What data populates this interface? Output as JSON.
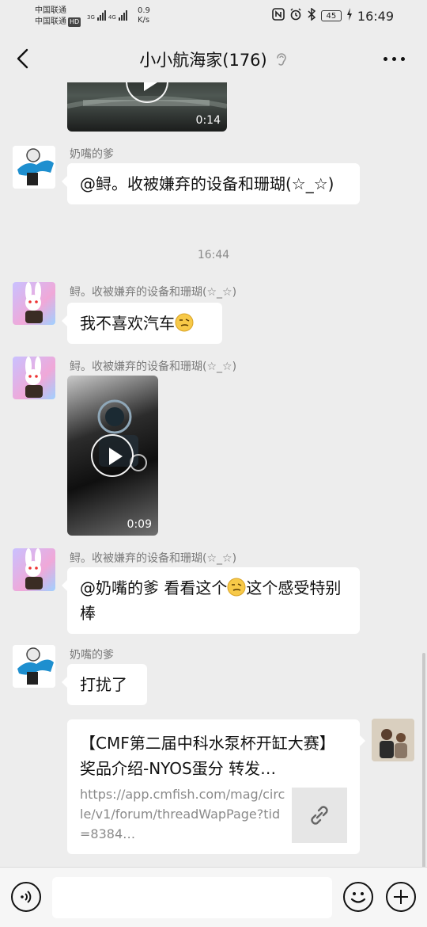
{
  "status_bar": {
    "carrier_1": "中国联通",
    "carrier_2": "中国联通",
    "hd": "HD",
    "net_1": "3G",
    "net_2": "4G",
    "speed_value": "0.9",
    "speed_unit": "K/s",
    "battery": "45",
    "time": "16:49"
  },
  "header": {
    "title": "小小航海家(176)"
  },
  "messages": [
    {
      "type": "video",
      "duration": "0:14"
    },
    {
      "type": "text",
      "sender": "奶嘴的爹",
      "text": "@鲟。收被嫌弃的设备和珊瑚(☆_☆)"
    },
    {
      "type": "timestamp",
      "text": "16:44"
    },
    {
      "type": "text",
      "sender": "鲟。收被嫌弃的设备和珊瑚(☆_☆)",
      "text": "我不喜欢汽车"
    },
    {
      "type": "video",
      "sender": "鲟。收被嫌弃的设备和珊瑚(☆_☆)",
      "duration": "0:09"
    },
    {
      "type": "text",
      "sender": "鲟。收被嫌弃的设备和珊瑚(☆_☆)",
      "text_a": "@奶嘴的爹  看看这个",
      "text_b": "这个感受特别棒"
    },
    {
      "type": "text",
      "sender": "奶嘴的爹",
      "text": "打扰了"
    },
    {
      "type": "link",
      "title": "【CMF第二届中科水泵杯开缸大赛】奖品介绍-NYOS蛋分 转发…",
      "url": "https://app.cmfish.com/mag/circle/v1/forum/threadWapPage?tid=8384…"
    }
  ],
  "input": {
    "placeholder": ""
  },
  "icons": {
    "back": "back-arrow-icon",
    "ear": "ear-icon",
    "more": "more-icon",
    "voice": "voice-icon",
    "emoji": "emoji-icon",
    "plus": "plus-icon",
    "link": "link-icon",
    "play": "play-icon"
  }
}
